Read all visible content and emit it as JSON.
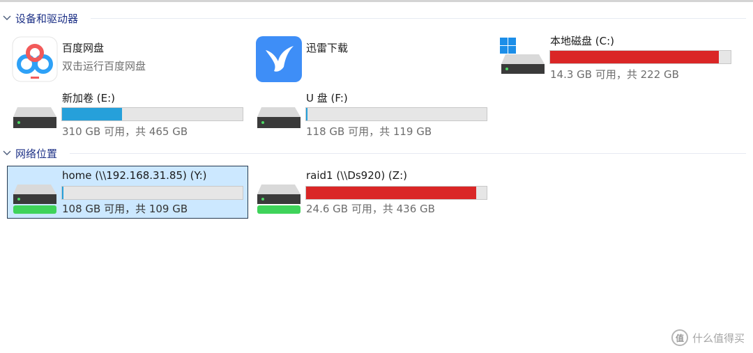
{
  "colors": {
    "bar_blue": "#26a0da",
    "bar_red": "#da2626",
    "section_title": "#1e3287",
    "selected_bg": "#cce8ff"
  },
  "sections": {
    "devices": {
      "title": "设备和驱动器"
    },
    "network": {
      "title": "网络位置"
    }
  },
  "devices": {
    "baidu": {
      "name": "百度网盘",
      "sub": "双击运行百度网盘",
      "icon": "baidu-netdisk-icon"
    },
    "xunlei": {
      "name": "迅雷下载",
      "icon": "xunlei-bird-icon"
    },
    "c_drive": {
      "name": "本地磁盘 (C:)",
      "usage": "14.3 GB 可用，共 222 GB",
      "free_gb": 14.3,
      "total_gb": 222,
      "icon": "windows-drive-icon"
    },
    "e_drive": {
      "name": "新加卷 (E:)",
      "usage": "310 GB 可用，共 465 GB",
      "free_gb": 310,
      "total_gb": 465,
      "icon": "hard-drive-icon"
    },
    "f_drive": {
      "name": "U 盘 (F:)",
      "usage": "118 GB 可用，共 119 GB",
      "free_gb": 118,
      "total_gb": 119,
      "icon": "hard-drive-icon"
    }
  },
  "network": {
    "home": {
      "name": "home (\\\\192.168.31.85) (Y:)",
      "usage": "108 GB 可用，共 109 GB",
      "free_gb": 108,
      "total_gb": 109,
      "icon": "network-drive-icon",
      "selected": true
    },
    "raid1": {
      "name": "raid1 (\\\\Ds920) (Z:)",
      "usage": "24.6 GB 可用，共 436 GB",
      "free_gb": 24.6,
      "total_gb": 436,
      "icon": "network-drive-icon"
    }
  },
  "watermark": {
    "text": "什么值得买",
    "logo": "值"
  }
}
